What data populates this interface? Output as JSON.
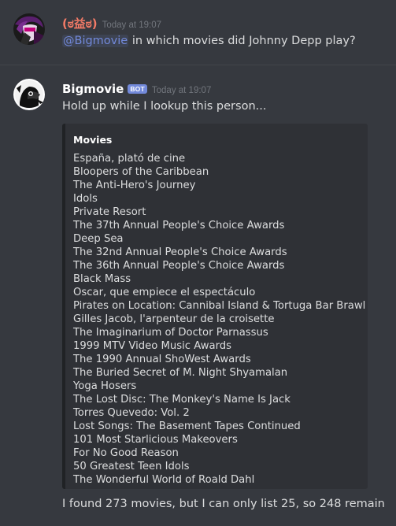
{
  "messages": {
    "user": {
      "username": "(ಠ益ಠ)",
      "username_color": "#f47b67",
      "timestamp": "Today at 19:07",
      "mention": "@Bigmovie",
      "text": " in which movies did Johnny Depp play?"
    },
    "bot": {
      "username": "Bigmovie",
      "username_color": "#ffffff",
      "bot_tag": "BOT",
      "timestamp": "Today at 19:07",
      "text": "Hold up while I lookup this person...",
      "embed": {
        "title": "Movies",
        "items": [
          "España, plató de cine",
          "Bloopers of the Caribbean",
          "The Anti-Hero's Journey",
          "Idols",
          "Private Resort",
          "The 37th Annual People's Choice Awards",
          "Deep Sea",
          "The 32nd Annual People's Choice Awards",
          "The 36th Annual People's Choice Awards",
          "Black Mass",
          "Oscar, que empiece el espectáculo",
          "Pirates on Location: Cannibal Island & Tortuga Bar Brawl",
          "Gilles Jacob, l'arpenteur de la croisette",
          "The Imaginarium of Doctor Parnassus",
          "1999 MTV Video Music Awards",
          "The 1990 Annual ShoWest Awards",
          "The Buried Secret of M. Night Shyamalan",
          "Yoga Hosers",
          "The Lost Disc: The Monkey's Name Is Jack",
          "Torres Quevedo: Vol. 2",
          "Lost Songs: The Basement Tapes Continued",
          "101 Most Starlicious Makeovers",
          "For No Good Reason",
          "50 Greatest Teen Idols",
          "The Wonderful World of Roald Dahl"
        ]
      },
      "footer_text": "I found 273 movies, but I can only list 25, so 248 remain"
    }
  },
  "colors": {
    "background": "#36393f",
    "embed_background": "#2f3136",
    "mention": "#7289da",
    "bot_tag": "#7289da"
  }
}
